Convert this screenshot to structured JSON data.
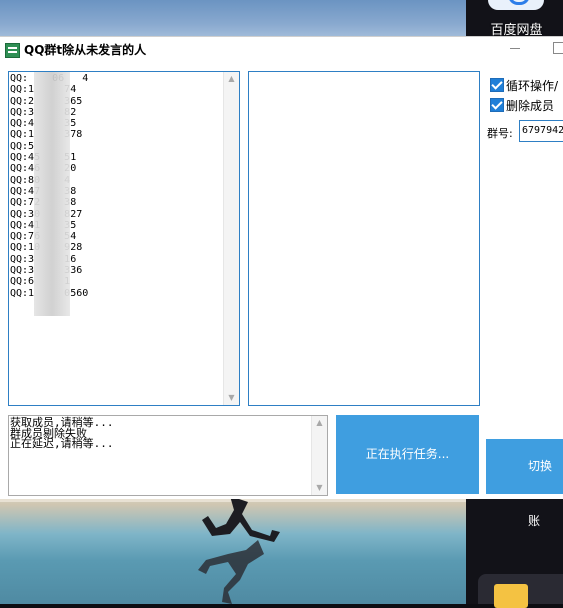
{
  "desktop": {
    "top_right_icon_label": "百度网盘"
  },
  "window": {
    "title": "QQ群t除从未发言的人"
  },
  "qq_list": {
    "items": [
      "QQ:    06   4",
      "QQ:1     74",
      "QQ:2     365",
      "QQ:3     82",
      "QQ:4     35",
      "QQ:1     378",
      "QQ:5",
      "QQ:45    51",
      "QQ:46    20",
      "QQ:80    4",
      "QQ:47    38",
      "QQ:72    38",
      "QQ:30    827",
      "QQ:41    35",
      "QQ:76    54",
      "QQ:10    928",
      "QQ:3     16",
      "QQ:3     336",
      "QQ:6     1",
      "QQ:1     0560"
    ]
  },
  "options": {
    "loop_label": "循环操作/",
    "delete_label": "删除成员",
    "loop_checked": true,
    "delete_checked": true
  },
  "group": {
    "label": "群号:",
    "value": "6797942"
  },
  "log": {
    "lines": [
      "获取成员,请稍等...",
      "群成员剔除失败",
      "正在延迟,请稍等..."
    ]
  },
  "buttons": {
    "running": "正在执行任务...",
    "switch_account": "切换账"
  }
}
